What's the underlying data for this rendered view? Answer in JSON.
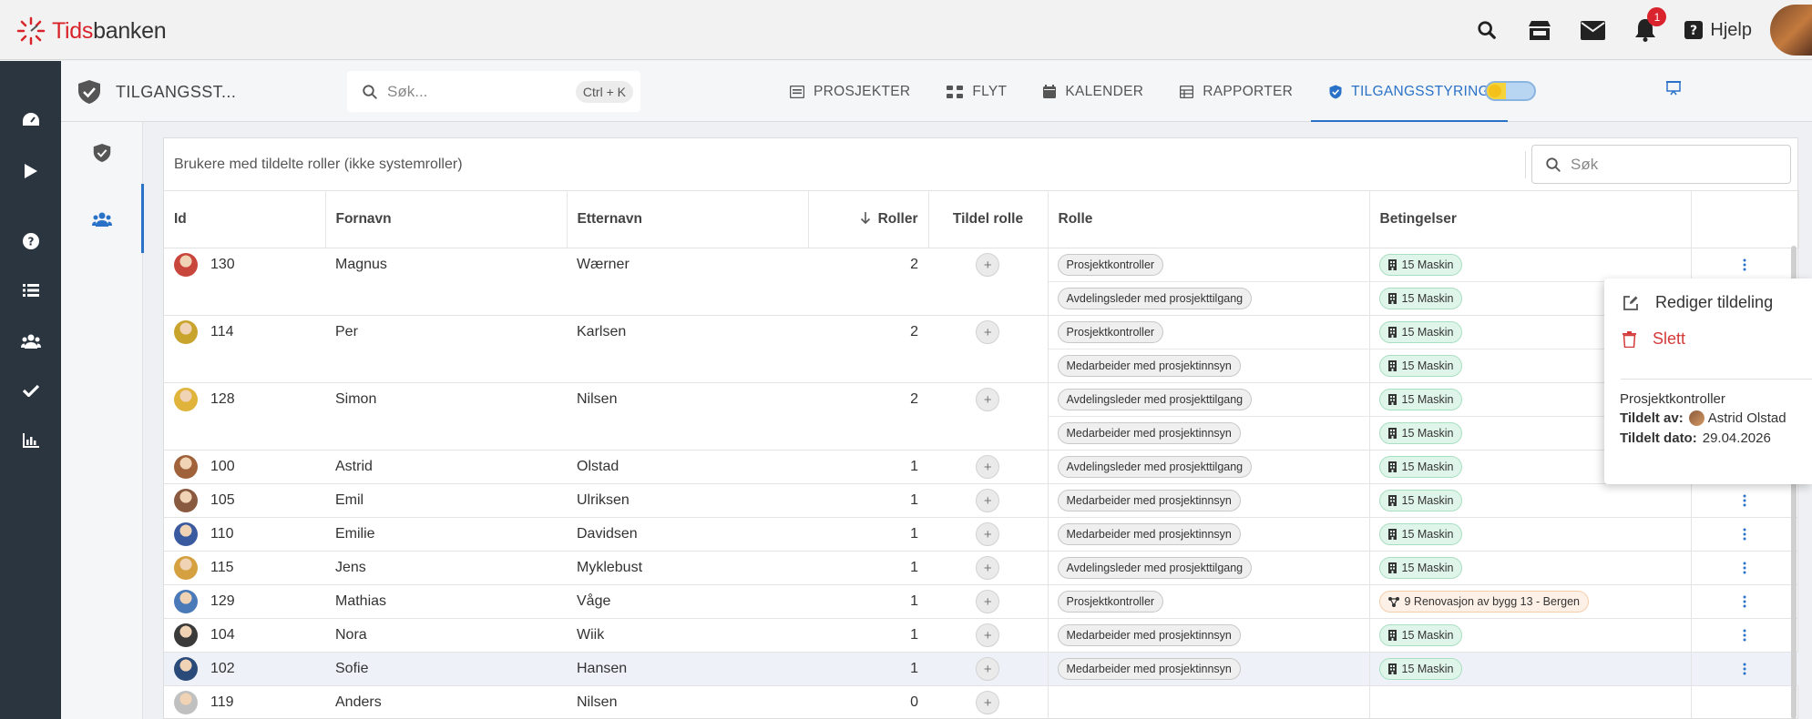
{
  "app": {
    "brand_part1": "Tids",
    "brand_part2": "banken",
    "help_label": "Hjelp",
    "notification_count": "1"
  },
  "subheader": {
    "title": "TILGANGSST...",
    "search_placeholder": "Søk...",
    "shortcut": "Ctrl + K",
    "tabs": [
      {
        "label": "PROSJEKTER",
        "icon": "projects-icon"
      },
      {
        "label": "FLYT",
        "icon": "flow-icon"
      },
      {
        "label": "KALENDER",
        "icon": "calendar-icon"
      },
      {
        "label": "RAPPORTER",
        "icon": "report-icon"
      },
      {
        "label": "TILGANGSSTYRING",
        "icon": "shield-check-icon",
        "active": true
      }
    ]
  },
  "card": {
    "title": "Brukere med tildelte roller (ikke systemroller)",
    "search_placeholder": "Søk",
    "columns": {
      "id": "Id",
      "firstname": "Fornavn",
      "lastname": "Etternavn",
      "roles": "Roller",
      "assign": "Tildel rolle",
      "role": "Rolle",
      "conditions": "Betingelser"
    },
    "rows": [
      {
        "id": "130",
        "first": "Magnus",
        "last": "Wærner",
        "count": "2",
        "color": "#c8463c",
        "assignments": [
          {
            "role": "Prosjektkontroller",
            "cond": "15 Maskin"
          },
          {
            "role": "Avdelingsleder med prosjekttilgang",
            "cond": "15 Maskin"
          }
        ]
      },
      {
        "id": "114",
        "first": "Per",
        "last": "Karlsen",
        "count": "2",
        "color": "#c8a42c",
        "assignments": [
          {
            "role": "Prosjektkontroller",
            "cond": "15 Maskin"
          },
          {
            "role": "Medarbeider med prosjektinnsyn",
            "cond": "15 Maskin"
          }
        ]
      },
      {
        "id": "128",
        "first": "Simon",
        "last": "Nilsen",
        "count": "2",
        "color": "#e0b43a",
        "assignments": [
          {
            "role": "Avdelingsleder med prosjekttilgang",
            "cond": "15 Maskin"
          },
          {
            "role": "Medarbeider med prosjektinnsyn",
            "cond": "15 Maskin"
          }
        ]
      },
      {
        "id": "100",
        "first": "Astrid",
        "last": "Olstad",
        "count": "1",
        "color": "#a0623a",
        "assignments": [
          {
            "role": "Avdelingsleder med prosjekttilgang",
            "cond": "15 Maskin"
          }
        ]
      },
      {
        "id": "105",
        "first": "Emil",
        "last": "Ulriksen",
        "count": "1",
        "color": "#8a5a40",
        "assignments": [
          {
            "role": "Medarbeider med prosjektinnsyn",
            "cond": "15 Maskin"
          }
        ]
      },
      {
        "id": "110",
        "first": "Emilie",
        "last": "Davidsen",
        "count": "1",
        "color": "#3a5aa0",
        "assignments": [
          {
            "role": "Medarbeider med prosjektinnsyn",
            "cond": "15 Maskin"
          }
        ]
      },
      {
        "id": "115",
        "first": "Jens",
        "last": "Myklebust",
        "count": "1",
        "color": "#d4a040",
        "assignments": [
          {
            "role": "Avdelingsleder med prosjekttilgang",
            "cond": "15 Maskin"
          }
        ]
      },
      {
        "id": "129",
        "first": "Mathias",
        "last": "Våge",
        "count": "1",
        "color": "#4a7ab8",
        "assignments": [
          {
            "role": "Prosjektkontroller",
            "cond": "9 Renovasjon av bygg 13 - Bergen",
            "cond_type": "orange"
          }
        ]
      },
      {
        "id": "104",
        "first": "Nora",
        "last": "Wiik",
        "count": "1",
        "color": "#3a3a3a",
        "assignments": [
          {
            "role": "Medarbeider med prosjektinnsyn",
            "cond": "15 Maskin"
          }
        ]
      },
      {
        "id": "102",
        "first": "Sofie",
        "last": "Hansen",
        "count": "1",
        "color": "#2a4a7a",
        "highlighted": true,
        "assignments": [
          {
            "role": "Medarbeider med prosjektinnsyn",
            "cond": "15 Maskin"
          }
        ]
      },
      {
        "id": "119",
        "first": "Anders",
        "last": "Nilsen",
        "count": "0",
        "color": "#c0c0c0",
        "assignments": []
      }
    ]
  },
  "popup": {
    "edit_label": "Rediger tildeling",
    "delete_label": "Slett",
    "role": "Prosjektkontroller",
    "assigned_by_label": "Tildelt av:",
    "assigned_by": "Astrid Olstad",
    "assigned_date_label": "Tildelt dato:",
    "assigned_date": "29.04.2026"
  },
  "colors": {
    "accent": "#2a72c8",
    "brand_red": "#d8232a",
    "sidebar": "#2a3540",
    "danger": "#d33a3a"
  }
}
